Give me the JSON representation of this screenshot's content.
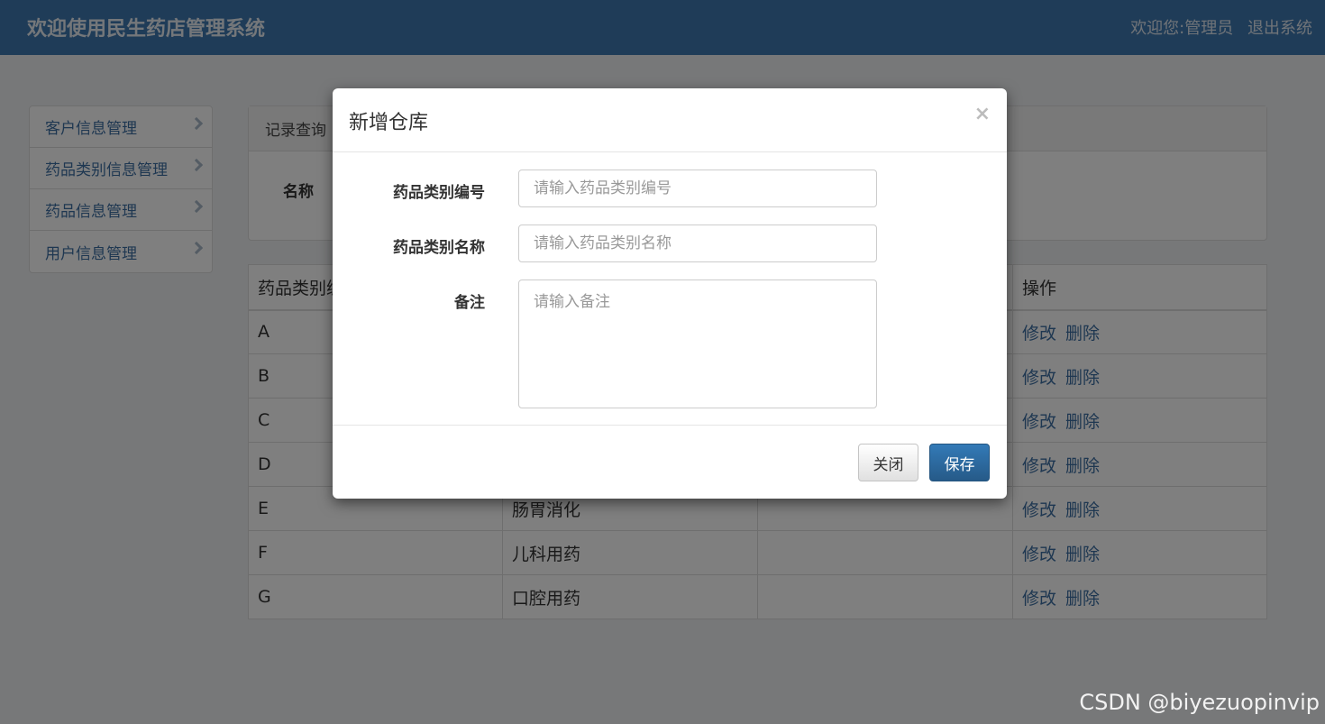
{
  "header": {
    "title": "欢迎使用民生药店管理系统",
    "welcome": "欢迎您:",
    "username": "管理员",
    "logout": "退出系统"
  },
  "sidebar": {
    "items": [
      {
        "label": "客户信息管理"
      },
      {
        "label": "药品类别信息管理"
      },
      {
        "label": "药品信息管理"
      },
      {
        "label": "用户信息管理"
      }
    ]
  },
  "query_panel": {
    "title": "记录查询",
    "name_label": "名称"
  },
  "table": {
    "headers": [
      "药品类别编号",
      "",
      "",
      "操作"
    ],
    "rows": [
      {
        "code": "A",
        "name": ""
      },
      {
        "code": "B",
        "name": ""
      },
      {
        "code": "C",
        "name": ""
      },
      {
        "code": "D",
        "name": ""
      },
      {
        "code": "E",
        "name": "肠胃消化"
      },
      {
        "code": "F",
        "name": "儿科用药"
      },
      {
        "code": "G",
        "name": "口腔用药"
      }
    ],
    "edit_label": "修改",
    "delete_label": "删除"
  },
  "modal": {
    "title": "新增仓库",
    "close_icon": "×",
    "fields": [
      {
        "label": "药品类别编号",
        "placeholder": "请输入药品类别编号",
        "value": ""
      },
      {
        "label": "药品类别名称",
        "placeholder": "请输入药品类别名称",
        "value": ""
      },
      {
        "label": "备注",
        "placeholder": "请输入备注",
        "value": ""
      }
    ],
    "close_button": "关闭",
    "save_button": "保存"
  },
  "watermark": "CSDN @biyezuopinvip",
  "colors": {
    "header_bg": "#3f79b0",
    "primary": "#337ab7",
    "link": "#3c6ea3"
  }
}
